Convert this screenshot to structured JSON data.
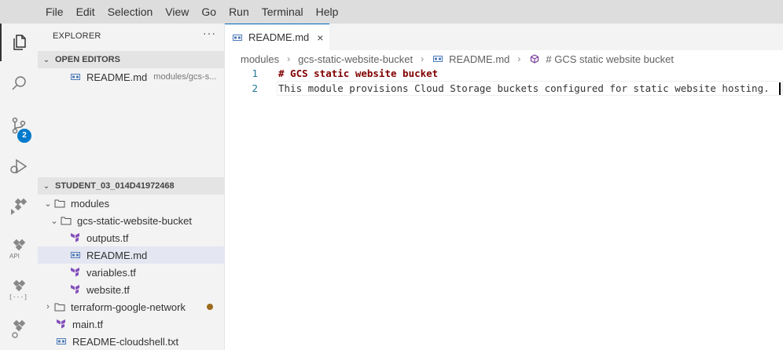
{
  "menu": [
    "File",
    "Edit",
    "Selection",
    "View",
    "Go",
    "Run",
    "Terminal",
    "Help"
  ],
  "activity": {
    "scm_badge": "2",
    "api_label": "API",
    "code_label": "[···]"
  },
  "explorer": {
    "title": "EXPLORER",
    "more": "···",
    "open_editors_header": "OPEN EDITORS",
    "open_editors": [
      {
        "name": "README.md",
        "path": "modules/gcs-s..."
      }
    ],
    "workspace_header": "STUDENT_03_014D41972468",
    "tree": {
      "modules": "modules",
      "gcs_folder": "gcs-static-website-bucket",
      "gcs_files": [
        "outputs.tf",
        "README.md",
        "variables.tf",
        "website.tf"
      ],
      "network_folder": "terraform-google-network",
      "main": "main.tf",
      "readme_cloudshell": "README-cloudshell.txt"
    }
  },
  "editor": {
    "tab_label": "README.md",
    "tab_close": "×",
    "breadcrumb": [
      "modules",
      "gcs-static-website-bucket",
      "README.md",
      "# GCS static website bucket"
    ],
    "lines": [
      {
        "num": "1",
        "text": "# GCS static website bucket"
      },
      {
        "num": "2",
        "text": "This module provisions Cloud Storage buckets configured for static website hosting."
      }
    ]
  },
  "colors": {
    "accent": "#007acc",
    "tab_border": "#0066b8",
    "heading": "#800000",
    "terraform_icon": "#844fba",
    "modified_dot": "#9b6a1c"
  }
}
